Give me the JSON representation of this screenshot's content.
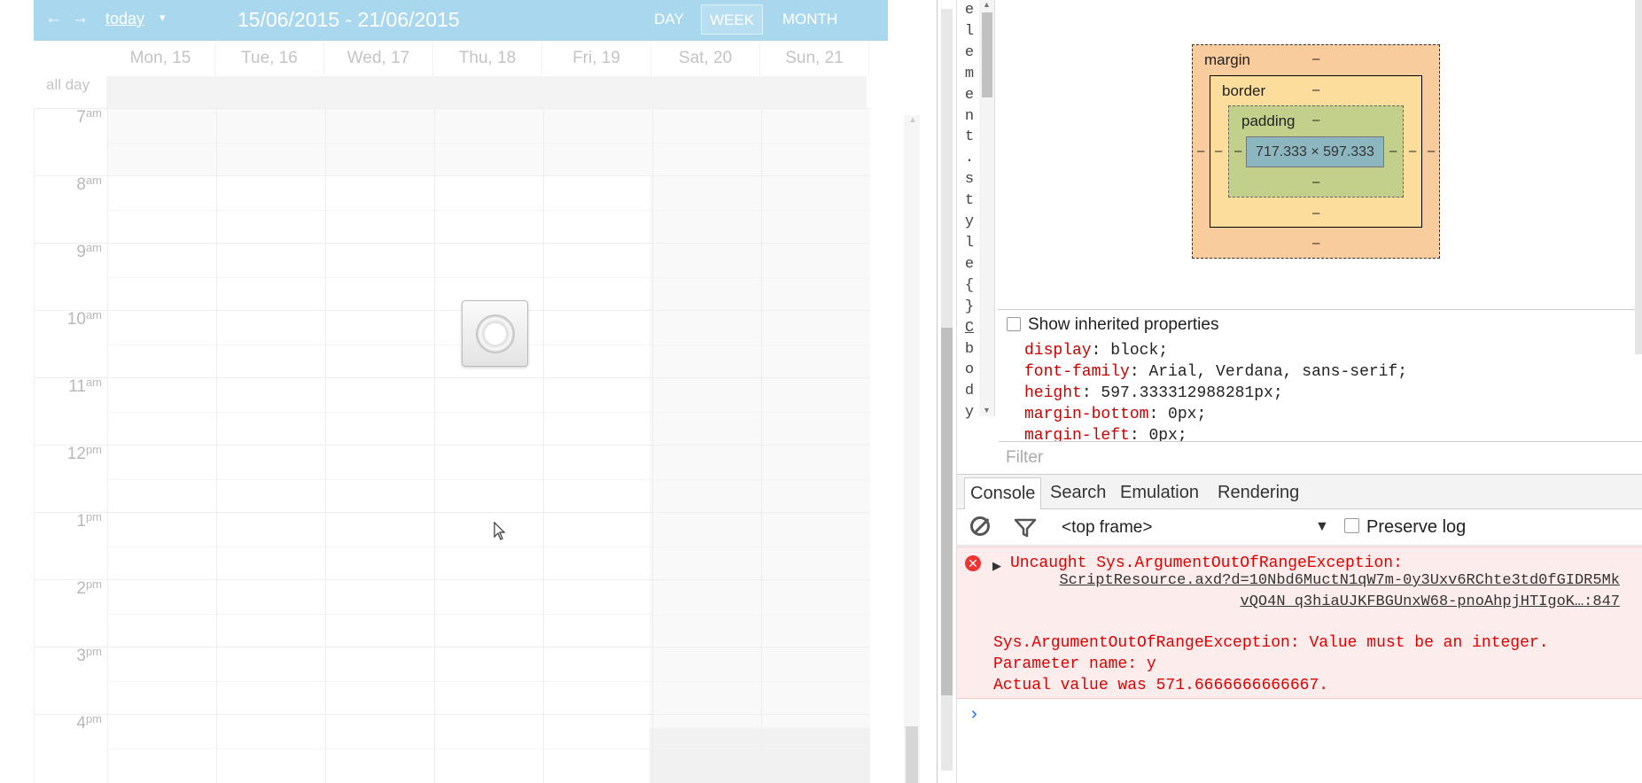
{
  "calendar": {
    "nav_prev": "←",
    "nav_next": "→",
    "today_label": "today",
    "today_caret": "▾",
    "range": "15/06/2015 - 21/06/2015",
    "views": {
      "day": "DAY",
      "week": "WEEK",
      "month": "MONTH"
    },
    "days": [
      "Mon, 15",
      "Tue, 16",
      "Wed, 17",
      "Thu, 18",
      "Fri, 19",
      "Sat, 20",
      "Sun, 21"
    ],
    "all_day_label": "all day",
    "hours": [
      {
        "h": "7",
        "p": "am"
      },
      {
        "h": "8",
        "p": "am"
      },
      {
        "h": "9",
        "p": "am"
      },
      {
        "h": "10",
        "p": "am"
      },
      {
        "h": "11",
        "p": "am"
      },
      {
        "h": "12",
        "p": "pm"
      },
      {
        "h": "1",
        "p": "pm"
      },
      {
        "h": "2",
        "p": "pm"
      },
      {
        "h": "3",
        "p": "pm"
      },
      {
        "h": "4",
        "p": "pm"
      }
    ],
    "colors": {
      "toolbar": "#a9d8ee",
      "weekend": "#f9f9f9"
    }
  },
  "devtools": {
    "vertical_text": [
      "e",
      "l",
      "e",
      "m",
      "e",
      "n",
      "t",
      ".",
      "s",
      "t",
      "y",
      "l",
      "e",
      "{",
      "}",
      "C",
      "b",
      "o",
      "d",
      "y"
    ],
    "box_model": {
      "margin_label": "margin",
      "border_label": "border",
      "padding_label": "padding",
      "content": "717.333 × 597.333",
      "dash": "–"
    },
    "show_inherited_label": "Show inherited properties",
    "props": [
      {
        "k": "display",
        "v": "block;"
      },
      {
        "k": "font-family",
        "v": "Arial, Verdana, sans-serif;"
      },
      {
        "k": "height",
        "v": "597.333312988281px;"
      },
      {
        "k": "margin-bottom",
        "v": "0px;"
      },
      {
        "k": "margin-left",
        "v": "0px;"
      }
    ],
    "filter_placeholder": "Filter",
    "tabs": [
      "Console",
      "Search",
      "Emulation",
      "Rendering"
    ],
    "frame_select": "<top frame>",
    "preserve_log_label": "Preserve log",
    "error": {
      "title": "Uncaught Sys.ArgumentOutOfRangeException:",
      "link": "ScriptResource.axd?d=10Nbd6MuctN1qW7m-0y3Uxv6RChte3td0fGIDR5MkvQO4N_q3hiaUJKFBGUnxW68-pnoAhpjHTIgoK…:847",
      "message": "Sys.ArgumentOutOfRangeException: Value must be an integer.\nParameter name: y\nActual value was 571.6666666666667."
    },
    "prompt": "›"
  }
}
